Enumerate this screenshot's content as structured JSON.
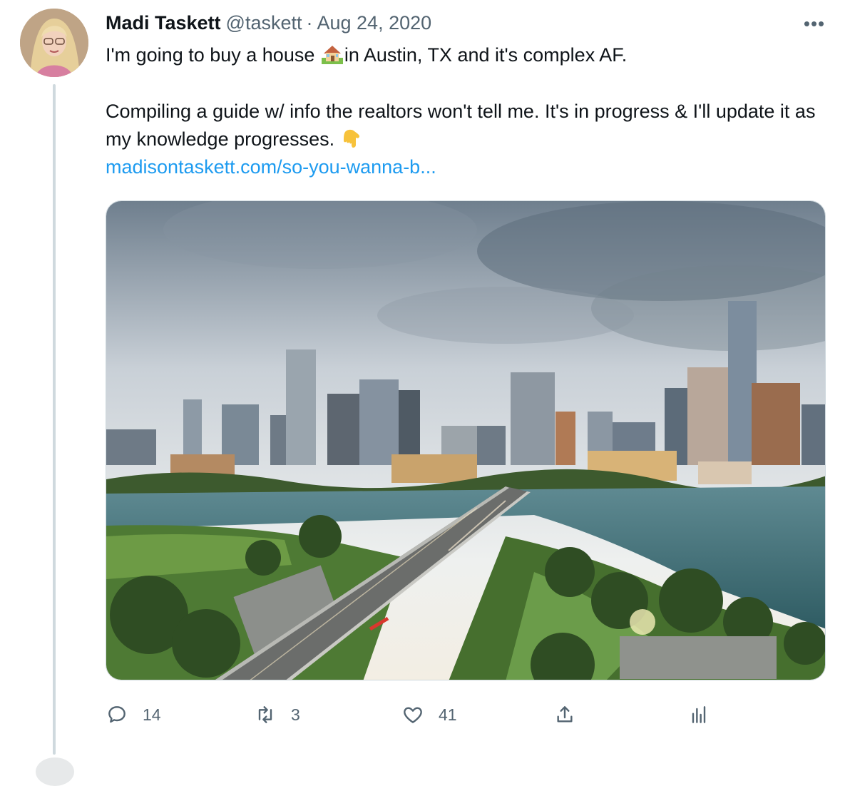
{
  "tweet": {
    "author_name": "Madi Taskett",
    "handle": "@taskett",
    "separator": "·",
    "date": "Aug 24, 2020",
    "more_label": "•••",
    "line1_before": "I'm going to buy a house ",
    "line1_after": "in Austin, TX and it's complex AF.",
    "para2": "Compiling a guide w/ info the realtors won't tell me. It's in progress & I'll update it as my knowledge progresses. ",
    "link_text": "madisontaskett.com/so-you-wanna-b..."
  },
  "actions": {
    "reply_count": "14",
    "retweet_count": "3",
    "like_count": "41"
  },
  "icons": {
    "reply": "reply-icon",
    "retweet": "retweet-icon",
    "like": "heart-icon",
    "share": "share-icon",
    "analytics": "analytics-icon",
    "house": "house-emoji-icon",
    "point_down": "point-down-emoji-icon"
  },
  "colors": {
    "link": "#1d9bf0",
    "secondary_text": "#536471",
    "thread_line": "#cfd9de"
  }
}
